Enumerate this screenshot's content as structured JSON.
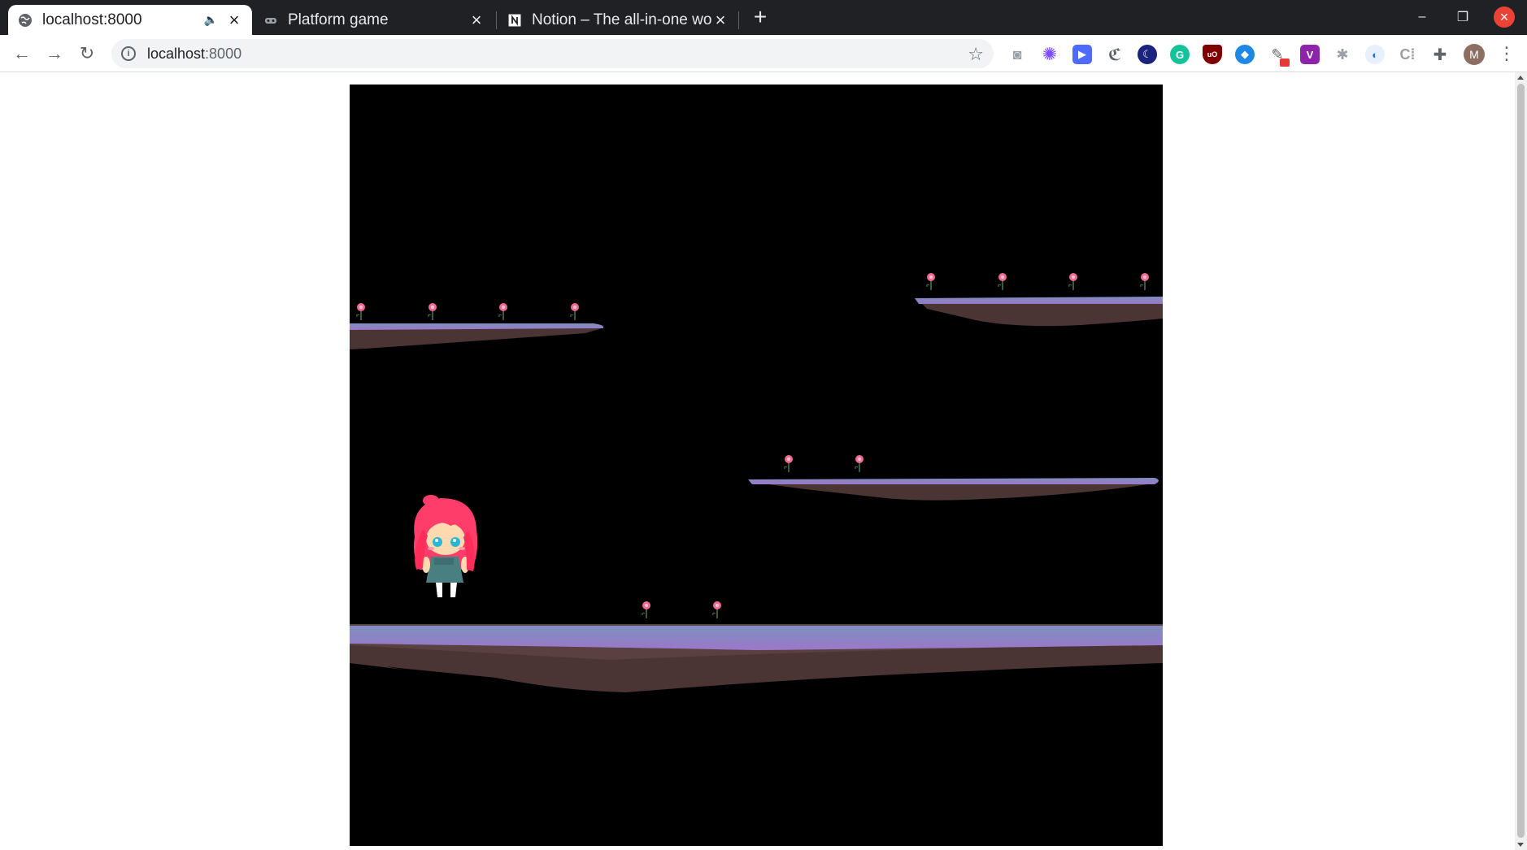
{
  "tabs": [
    {
      "title": "localhost:8000",
      "favicon": "globe-icon",
      "active": true,
      "audio": true
    },
    {
      "title": "Platform game",
      "favicon": "game-icon",
      "active": false
    },
    {
      "title": "Notion – The all-in-one wo",
      "favicon": "notion-icon",
      "active": false
    }
  ],
  "address": {
    "host": "localhost",
    "port": ":8000"
  },
  "extensions": [
    "camera-icon",
    "sparkle-extension-icon",
    "zoom-extension-icon",
    "c-extension-icon",
    "moon-extension-icon",
    "grammarly-icon",
    "ublock-icon",
    "diamond-extension-icon",
    "eyedropper-extension-icon",
    "v-extension-icon",
    "bug-extension-icon",
    "edge-extension-icon",
    "c3-extension-icon",
    "puzzle-icon"
  ],
  "profile": {
    "initial": "M"
  },
  "game": {
    "background": "#000000",
    "platform_top_color": "#8e7fc4",
    "platform_soil_color": "#4a3434",
    "flower_color": "#f06b93",
    "character": {
      "hair_color": "#ff3d6a",
      "dress_color": "#4a7f82",
      "eye_color": "#2bb5d9"
    }
  }
}
